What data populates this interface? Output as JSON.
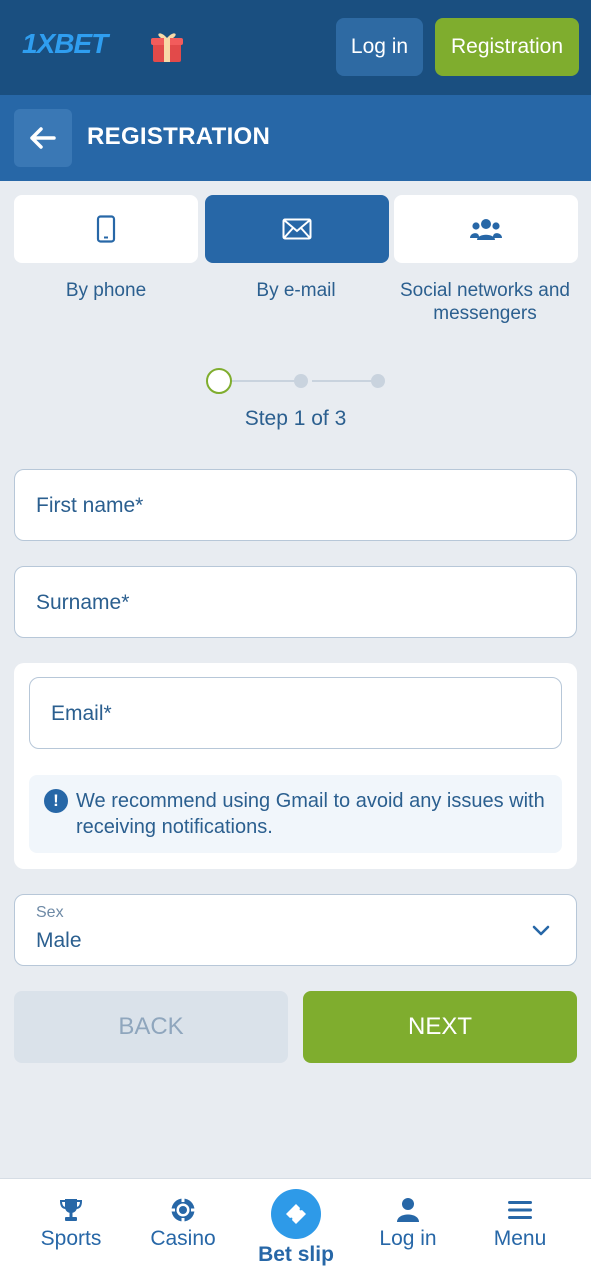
{
  "header": {
    "logo_text": "1XBET",
    "login_label": "Log in",
    "register_label": "Registration"
  },
  "titlebar": {
    "title": "REGISTRATION"
  },
  "methods": [
    {
      "label": "By phone",
      "icon": "phone-icon",
      "active": false
    },
    {
      "label": "By e-mail",
      "icon": "envelope-icon",
      "active": true
    },
    {
      "label": "Social networks and messengers",
      "icon": "users-icon",
      "active": false
    }
  ],
  "stepper": {
    "text": "Step 1 of 3",
    "current": 1,
    "total": 3
  },
  "form": {
    "first_name_placeholder": "First name*",
    "surname_placeholder": "Surname*",
    "email_placeholder": "Email*",
    "email_notice": "We recommend using Gmail to avoid any issues with receiving notifications.",
    "sex_label": "Sex",
    "sex_value": "Male",
    "back_label": "BACK",
    "next_label": "NEXT"
  },
  "bottom_nav": [
    {
      "label": "Sports",
      "icon": "trophy-icon"
    },
    {
      "label": "Casino",
      "icon": "casino-chip-icon"
    },
    {
      "label": "Bet slip",
      "icon": "ticket-icon"
    },
    {
      "label": "Log in",
      "icon": "user-icon"
    },
    {
      "label": "Menu",
      "icon": "hamburger-icon"
    }
  ],
  "colors": {
    "header_bg": "#1a4f80",
    "titlebar_bg": "#2767a7",
    "accent_green": "#7fad2e",
    "text_blue": "#2b5f8f",
    "page_bg": "#e8ecf1"
  }
}
